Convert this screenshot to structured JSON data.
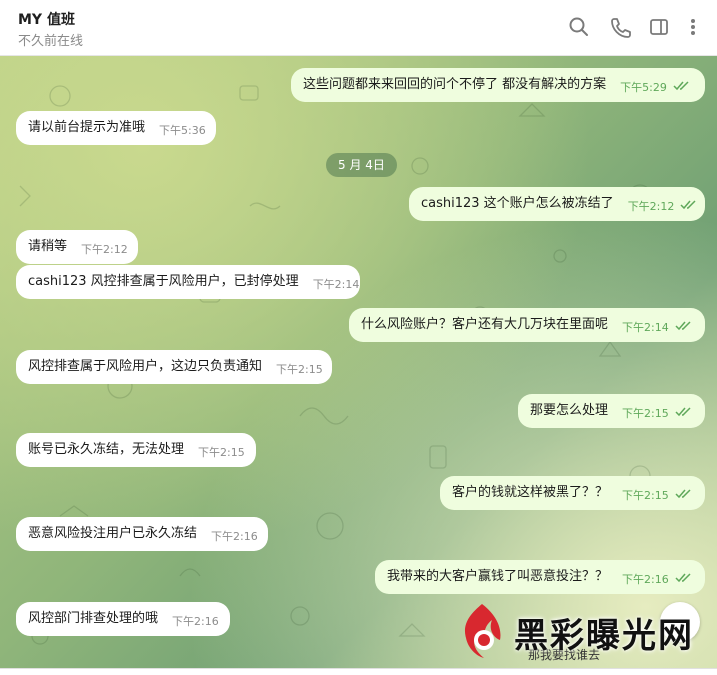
{
  "header": {
    "title": "MY 值班",
    "status": "不久前在线",
    "icons": [
      "search-icon",
      "phone-icon",
      "sidebar-toggle-icon",
      "more-vert-icon"
    ]
  },
  "date_divider": "5 月 4日",
  "messages": [
    {
      "side": "out",
      "text": "这些问题都来来回回的问个不停了 都没有解决的方案",
      "time": "下午5:29"
    },
    {
      "side": "in",
      "text": "请以前台提示为准哦",
      "time": "下午5:36"
    },
    {
      "side": "out",
      "text": "cashi123  这个账户怎么被冻结了",
      "time": "下午2:12"
    },
    {
      "side": "in",
      "text": "请稍等",
      "time": "下午2:12"
    },
    {
      "side": "in",
      "text": "cashi123 风控排查属于风险用户，已封停处理",
      "time": "下午2:14"
    },
    {
      "side": "out",
      "text": "什么风险账户？客户还有大几万块在里面呢",
      "time": "下午2:14"
    },
    {
      "side": "in",
      "text": "风控排查属于风险用户，这边只负责通知",
      "time": "下午2:15"
    },
    {
      "side": "out",
      "text": "那要怎么处理",
      "time": "下午2:15"
    },
    {
      "side": "in",
      "text": "账号已永久冻结，无法处理",
      "time": "下午2:15"
    },
    {
      "side": "out",
      "text": "客户的钱就这样被黑了？？",
      "time": "下午2:15"
    },
    {
      "side": "in",
      "text": "恶意风险投注用户已永久冻结",
      "time": "下午2:16"
    },
    {
      "side": "out",
      "text": "我带来的大客户赢钱了叫恶意投注？？",
      "time": "下午2:16"
    },
    {
      "side": "in",
      "text": "风控部门排查处理的哦",
      "time": "下午2:16"
    }
  ],
  "partial_message": "那我要找谁去",
  "watermark": "黑彩曝光网",
  "colors": {
    "incoming": "#ffffff",
    "outgoing": "#effdde",
    "check": "#5fa85a"
  }
}
